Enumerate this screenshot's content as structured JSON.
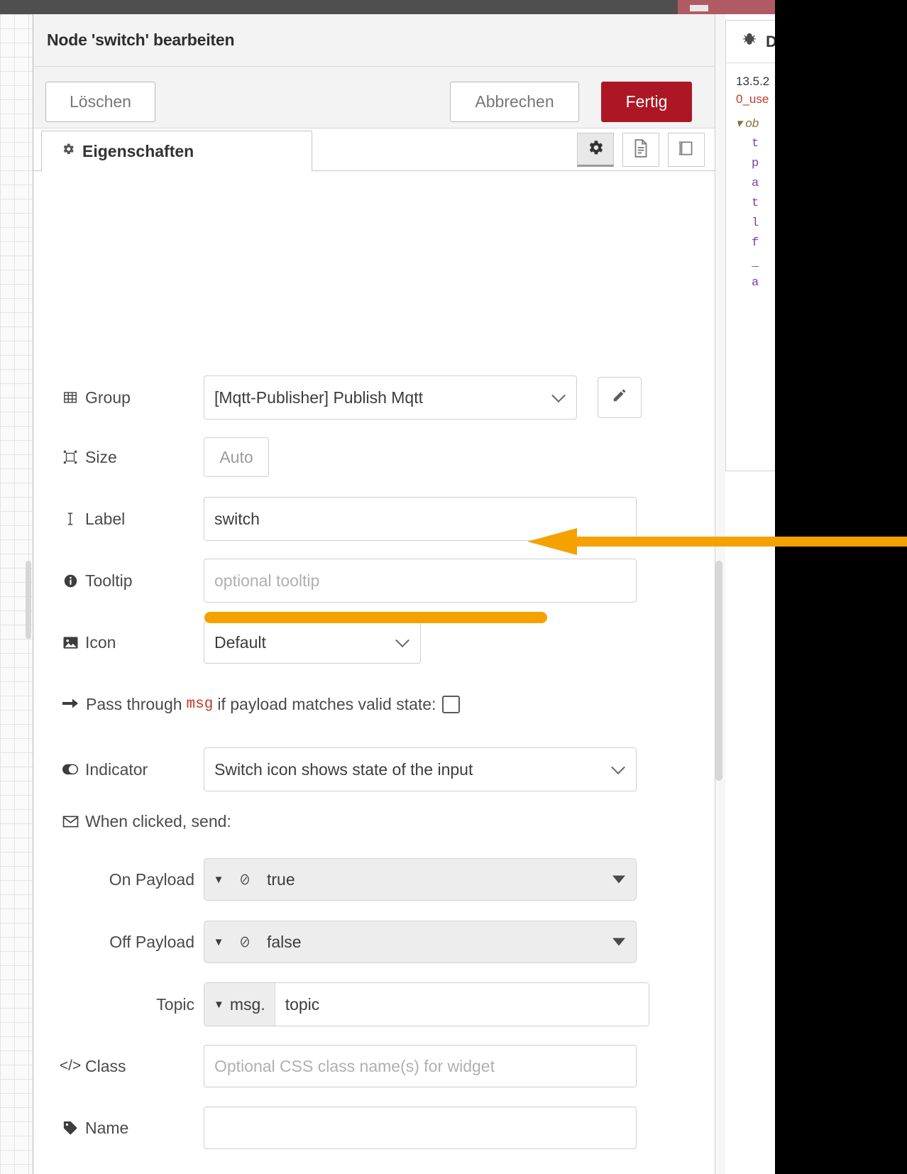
{
  "window": {
    "title": "Node 'switch' bearbeiten"
  },
  "toolbar": {
    "delete_label": "Löschen",
    "cancel_label": "Abbrechen",
    "done_label": "Fertig",
    "done_color": "#ad1625"
  },
  "tabs": {
    "properties_label": "Eigenschaften",
    "icon_buttons": [
      {
        "name": "properties-gear",
        "glyph": "gear",
        "active": true
      },
      {
        "name": "description-doc",
        "glyph": "document",
        "active": false
      },
      {
        "name": "appearance-layout",
        "glyph": "layout",
        "active": false
      }
    ]
  },
  "form": {
    "group": {
      "label": "Group",
      "value": "[Mqtt-Publisher] Publish Mqtt",
      "icon": "table-icon",
      "edit_icon": "pencil-icon"
    },
    "size": {
      "label": "Size",
      "value": "Auto",
      "icon": "resize-icon"
    },
    "label_field": {
      "label": "Label",
      "value": "switch",
      "icon": "text-cursor-icon"
    },
    "tooltip": {
      "label": "Tooltip",
      "value": "",
      "placeholder": "optional tooltip",
      "icon": "info-icon"
    },
    "icon_field": {
      "label": "Icon",
      "value": "Default",
      "icon": "image-icon"
    },
    "pass_through": {
      "text_before": "Pass through",
      "code": "msg",
      "text_after": "if payload matches valid state:",
      "checked": false,
      "icon": "arrow-right-icon"
    },
    "indicator": {
      "label": "Indicator",
      "value": "Switch icon shows state of the input",
      "icon": "toggle-icon"
    },
    "when_clicked": {
      "label": "When clicked, send:",
      "icon": "envelope-icon"
    },
    "on_payload": {
      "label": "On Payload",
      "type": "bool",
      "value": "true"
    },
    "off_payload": {
      "label": "Off Payload",
      "type": "bool",
      "value": "false"
    },
    "topic": {
      "label": "Topic",
      "prefix": "msg.",
      "value": "topic"
    },
    "css_class": {
      "label": "Class",
      "value": "",
      "placeholder": "Optional CSS class name(s) for widget",
      "icon": "code-icon"
    },
    "name": {
      "label": "Name",
      "value": "",
      "placeholder": "",
      "icon": "tag-icon"
    }
  },
  "annotations": {
    "arrow_color": "#f5a200",
    "underline_color": "#f5a200"
  },
  "debug_panel": {
    "title": "D",
    "timestamp": "13.5.2",
    "node_id": "0_use",
    "object_label": "ob",
    "lines": [
      "t",
      "p",
      "a",
      "t",
      "l",
      "f",
      "_",
      "a"
    ]
  }
}
